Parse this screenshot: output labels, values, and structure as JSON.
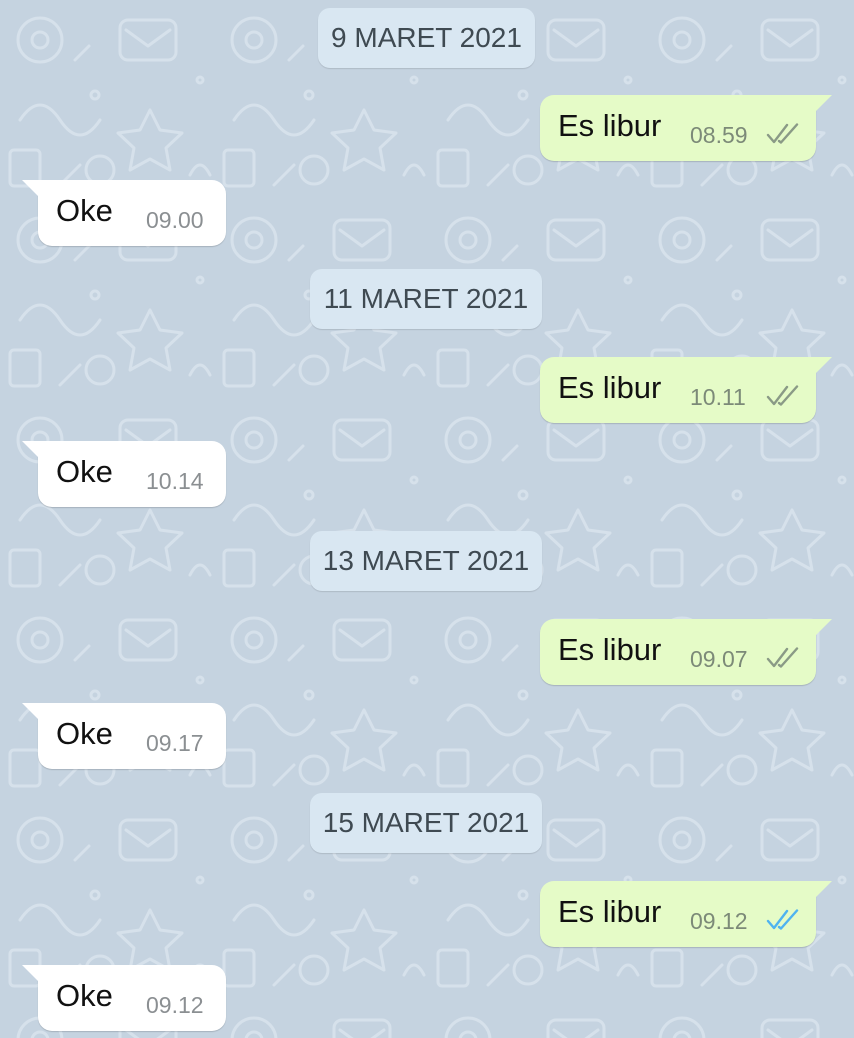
{
  "colors": {
    "wallpaper": "#c5d3e0",
    "date_chip": "#d9e7f2",
    "outgoing_bubble": "#e5fbc7",
    "incoming_bubble": "#ffffff",
    "tick_delivered": "#8a9a86",
    "tick_read": "#4fb3f0"
  },
  "conversation": {
    "day1": {
      "date": "9 MARET 2021",
      "outgoing": {
        "text": "Es libur",
        "time": "08.59",
        "status": "delivered"
      },
      "incoming": {
        "text": "Oke",
        "time": "09.00"
      }
    },
    "day2": {
      "date": "11 MARET 2021",
      "outgoing": {
        "text": "Es libur",
        "time": "10.11",
        "status": "delivered"
      },
      "incoming": {
        "text": "Oke",
        "time": "10.14"
      }
    },
    "day3": {
      "date": "13 MARET 2021",
      "outgoing": {
        "text": "Es libur",
        "time": "09.07",
        "status": "delivered"
      },
      "incoming": {
        "text": "Oke",
        "time": "09.17"
      }
    },
    "day4": {
      "date": "15 MARET 2021",
      "outgoing": {
        "text": "Es libur",
        "time": "09.12",
        "status": "read"
      },
      "incoming": {
        "text": "Oke",
        "time": "09.12"
      }
    }
  }
}
